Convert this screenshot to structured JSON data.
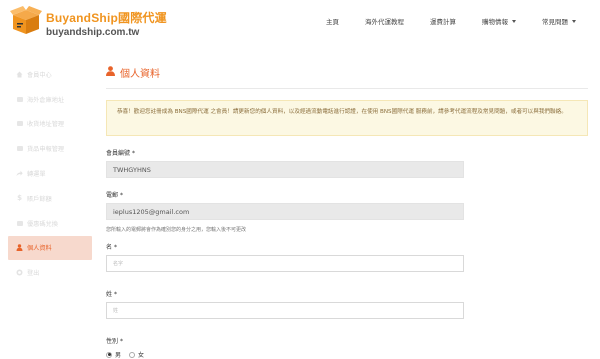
{
  "brand": {
    "name": "BuyandShip國際代運",
    "domain": "buyandship.com.tw",
    "box_color": "#f0941f"
  },
  "nav": {
    "items": [
      {
        "label": "主頁",
        "dropdown": false
      },
      {
        "label": "海外代運教程",
        "dropdown": false
      },
      {
        "label": "運費計算",
        "dropdown": false
      },
      {
        "label": "購物情報",
        "dropdown": true
      },
      {
        "label": "常見問題",
        "dropdown": true
      }
    ]
  },
  "sidebar": {
    "items": [
      {
        "label": "會員中心",
        "icon": "home-icon"
      },
      {
        "label": "海外倉庫地址",
        "icon": "warehouse-icon"
      },
      {
        "label": "收貨地址管理",
        "icon": "address-book-icon"
      },
      {
        "label": "貨品申報管理",
        "icon": "folder-icon"
      },
      {
        "label": "轉運單",
        "icon": "share-icon"
      },
      {
        "label": "賬戶餘額",
        "icon": "dollar-icon"
      },
      {
        "label": "優惠碼兌換",
        "icon": "gift-icon"
      },
      {
        "label": "個人資料",
        "icon": "user-icon",
        "active": true
      },
      {
        "label": "登出",
        "icon": "logout-icon"
      }
    ],
    "active_color": "#e8632a"
  },
  "main": {
    "title": "個人資料",
    "notice": "恭喜！歡迎您註冊成為 BNS國際代運 之會員！請更新您的個人資料，以及經過流動電話進行認證，在使用 BNS國際代運 服務前，請參考代運流程及常見問題，或者可以與我們聯絡。",
    "member_id": {
      "label": "會員編號",
      "required": "*",
      "value": "TWHGYHNS"
    },
    "email": {
      "label": "電郵",
      "required": "*",
      "value": "ieplus1205@gmail.com",
      "help": "您所輸入的電郵將會作為確別您的身分之用，您輸入後不可更改"
    },
    "first_name": {
      "label": "名",
      "required": "*",
      "placeholder": "名字"
    },
    "last_name": {
      "label": "姓",
      "required": "*",
      "placeholder": "姓"
    },
    "gender": {
      "label": "性別",
      "required": "*",
      "options": [
        "男",
        "女"
      ],
      "selected": "男"
    }
  }
}
